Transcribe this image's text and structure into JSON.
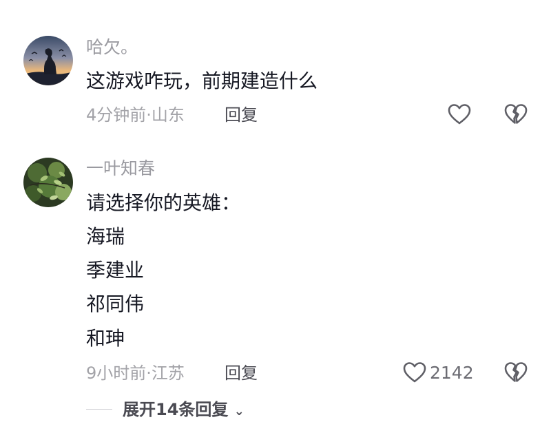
{
  "comments": [
    {
      "username": "哈欠。",
      "lines": [
        "这游戏咋玩，前期建造什么"
      ],
      "time": "4分钟前",
      "location": "山东",
      "meta": "4分钟前·山东",
      "reply_label": "回复",
      "like_count": "",
      "avatar_icon": "avatar-sunset-silhouette"
    },
    {
      "username": "一叶知春",
      "lines": [
        "请选择你的英雄：",
        "海瑞",
        "季建业",
        "祁同伟",
        "和珅"
      ],
      "time": "9小时前",
      "location": "江苏",
      "meta": "9小时前·江苏",
      "reply_label": "回复",
      "like_count": "2142",
      "avatar_icon": "avatar-green-leaves"
    }
  ],
  "expand_replies_label": "展开14条回复",
  "icons": {
    "like": "heart-outline-icon",
    "dislike": "broken-heart-icon",
    "expand": "chevron-down-icon"
  },
  "colors": {
    "username": "#9a9aa0",
    "content": "#161823",
    "meta": "#a3a3a8",
    "icon_stroke": "#5f5f66"
  }
}
